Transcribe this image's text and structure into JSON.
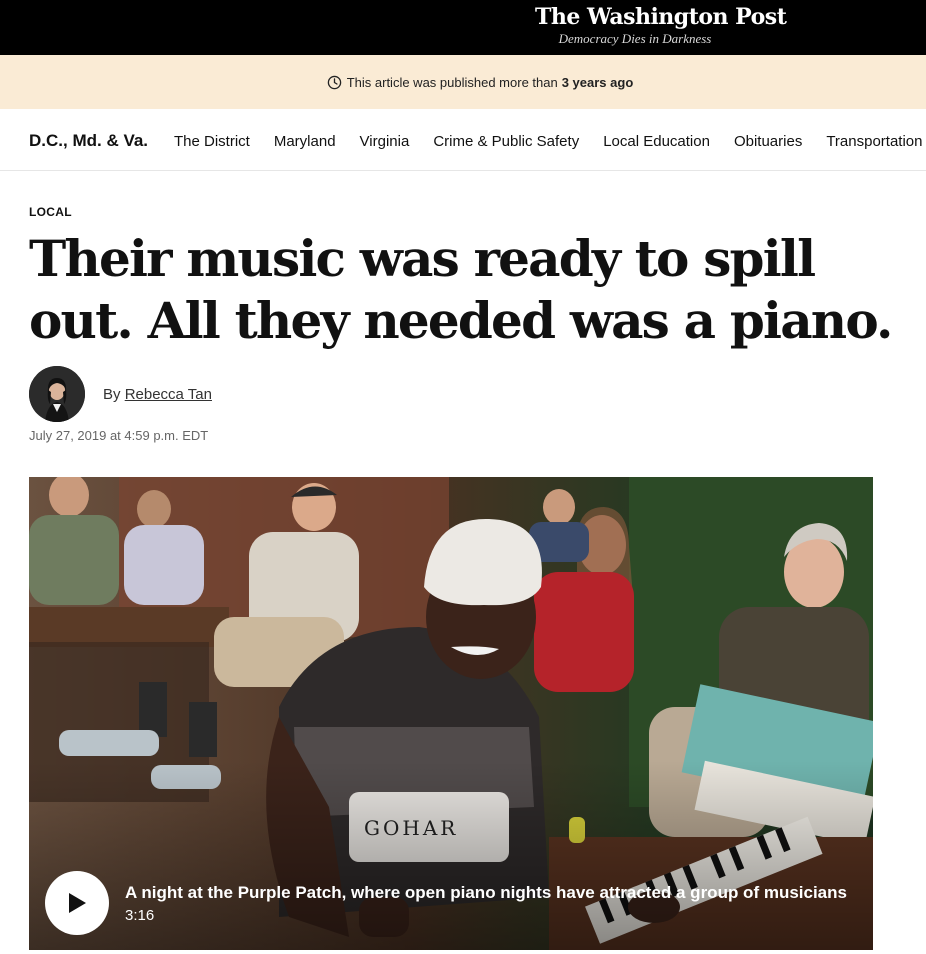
{
  "masthead": {
    "title": "The Washington Post",
    "tagline": "Democracy Dies in Darkness"
  },
  "notice": {
    "prefix": "This article was published more than",
    "age": "3 years ago",
    "icon": "clock-icon"
  },
  "section_nav": {
    "home": "D.C., Md. & Va.",
    "items": [
      "The District",
      "Maryland",
      "Virginia",
      "Crime & Public Safety",
      "Local Education",
      "Obituaries",
      "Transportation"
    ]
  },
  "article": {
    "kicker": "LOCAL",
    "headline": "Their music was ready to spill out. All they needed was a piano.",
    "byline_prefix": "By",
    "author": "Rebecca Tan",
    "date": "July 27, 2019 at 4:59 p.m. EDT"
  },
  "video": {
    "caption": "A night at the Purple Patch, where open piano nights have attracted a group of musicians",
    "duration": "3:16",
    "play_icon": "play-icon"
  },
  "colors": {
    "masthead_bg": "#000000",
    "notice_bg": "#faebd5",
    "text": "#111111"
  }
}
